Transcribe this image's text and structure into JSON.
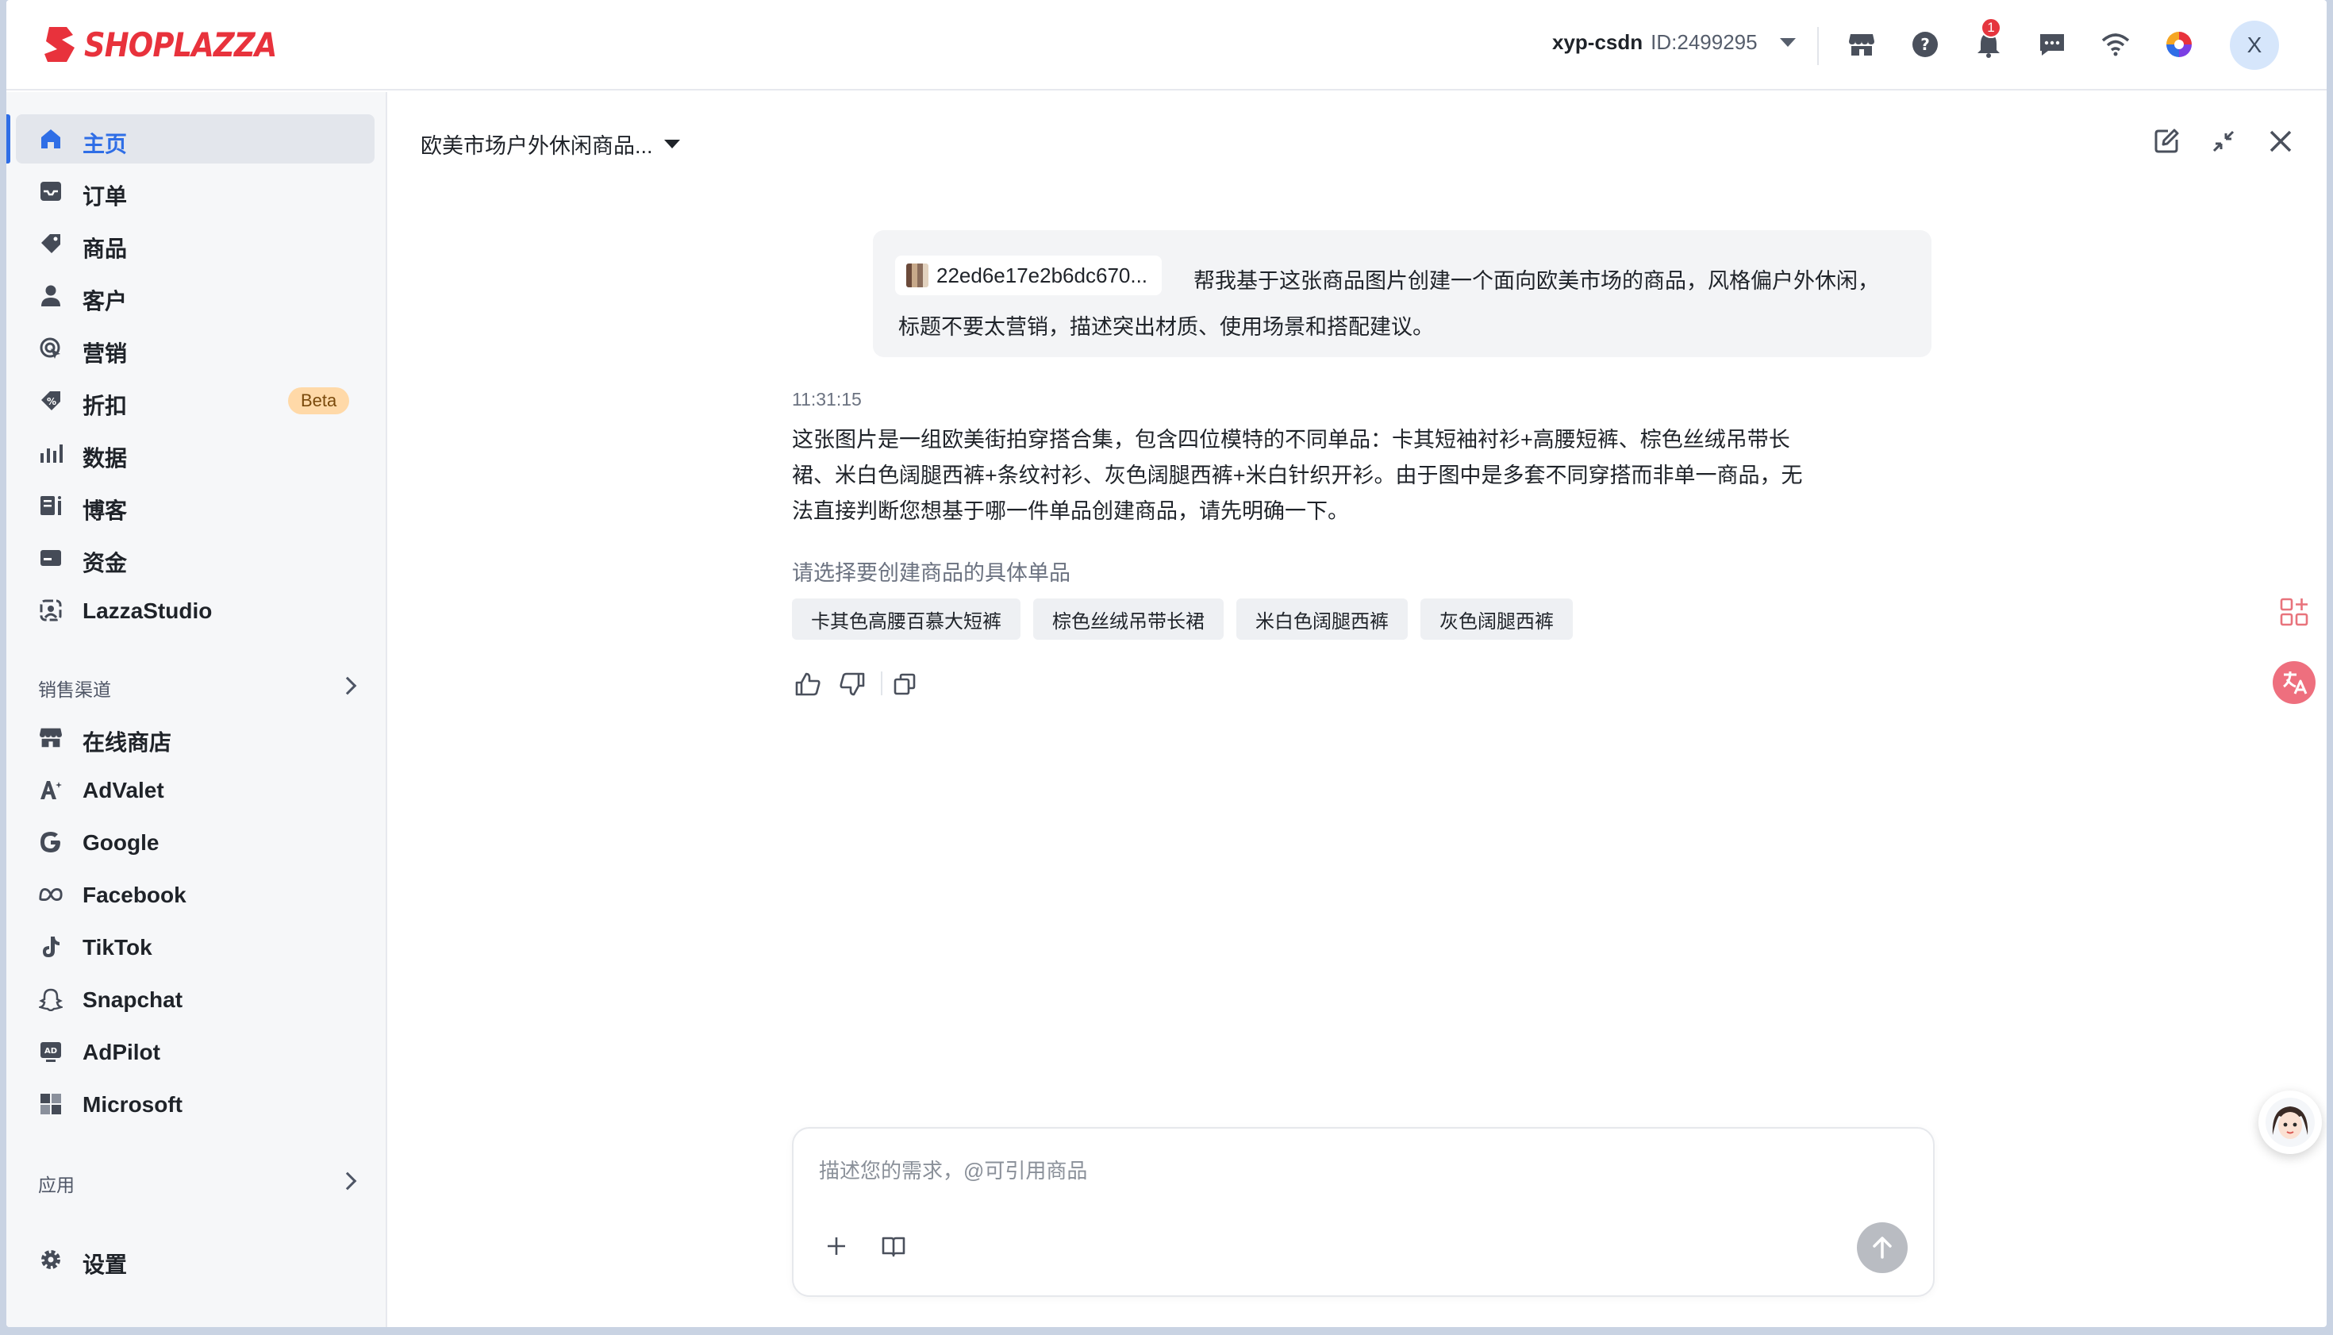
{
  "brand": {
    "name": "SHOPLAZZA",
    "color": "#e8323c"
  },
  "header": {
    "account_name": "xyp-csdn",
    "account_id": "ID:2499295",
    "notification_count": "1",
    "avatar_letter": "X",
    "icons": [
      "store-icon",
      "help-icon",
      "bell-icon",
      "message-icon",
      "wifi-icon",
      "color-wheel-icon"
    ]
  },
  "sidebar": {
    "accent": "#2f6ee6",
    "items": [
      {
        "label": "主页",
        "icon": "home-icon",
        "active": true
      },
      {
        "label": "订单",
        "icon": "inbox-icon"
      },
      {
        "label": "商品",
        "icon": "tag-icon"
      },
      {
        "label": "客户",
        "icon": "person-icon"
      },
      {
        "label": "营销",
        "icon": "target-icon"
      },
      {
        "label": "折扣",
        "icon": "discount-icon",
        "badge": "Beta"
      },
      {
        "label": "数据",
        "icon": "bar-chart-icon"
      },
      {
        "label": "博客",
        "icon": "blog-icon"
      },
      {
        "label": "资金",
        "icon": "wallet-icon"
      },
      {
        "label": "LazzaStudio",
        "icon": "studio-icon"
      }
    ],
    "sales_channels_title": "销售渠道",
    "channels": [
      {
        "label": "在线商店",
        "icon": "store-icon"
      },
      {
        "label": "AdValet",
        "icon": "advalet-icon"
      },
      {
        "label": "Google",
        "icon": "google-icon"
      },
      {
        "label": "Facebook",
        "icon": "meta-icon"
      },
      {
        "label": "TikTok",
        "icon": "tiktok-icon"
      },
      {
        "label": "Snapchat",
        "icon": "snapchat-icon"
      },
      {
        "label": "AdPilot",
        "icon": "adpilot-icon"
      },
      {
        "label": "Microsoft",
        "icon": "microsoft-icon"
      }
    ],
    "apps_title": "应用",
    "settings_label": "设置"
  },
  "chat": {
    "title": "欧美市场户外休闲商品...",
    "user_message": {
      "file_name": "22ed6e17e2b6dc670...",
      "text_line1": "帮我基于这张商品图片创建一个面向欧美市场的商品，风格偏户外休闲，",
      "text_line2": "标题不要太营销，描述突出材质、使用场景和搭配建议。"
    },
    "timestamp": "11:31:15",
    "reply_lines": [
      "这张图片是一组欧美街拍穿搭合集，包含四位模特的不同单品：卡其短袖衬衫+高腰短裤、棕色丝绒吊带长",
      "裙、米白色阔腿西裤+条纹衬衫、灰色阔腿西裤+米白针织开衫。由于图中是多套不同穿搭而非单一商品，无",
      "法直接判断您想基于哪一件单品创建商品，请先明确一下。"
    ],
    "prompt": "请选择要创建商品的具体单品",
    "options": [
      "卡其色高腰百慕大短裤",
      "棕色丝绒吊带长裙",
      "米白色阔腿西裤",
      "灰色阔腿西裤"
    ],
    "input_placeholder": "描述您的需求，@可引用商品"
  }
}
